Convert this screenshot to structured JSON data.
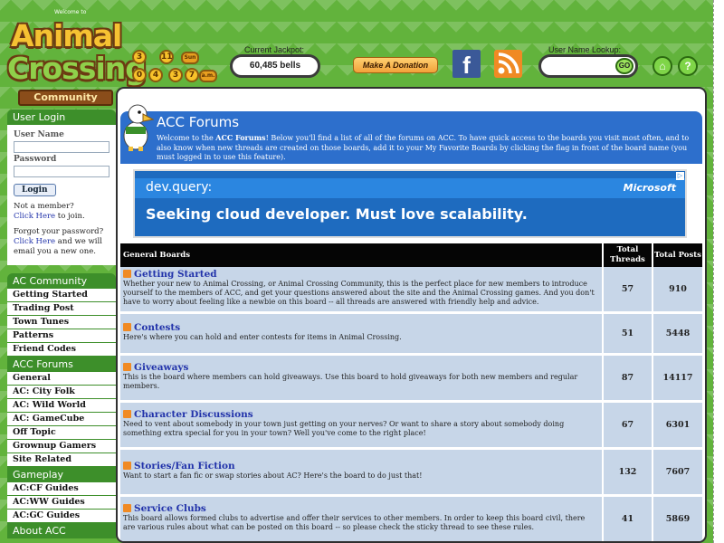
{
  "header": {
    "logo_welcome": "Welcome to",
    "logo_line1": "Animal",
    "logo_line2": "Crossing",
    "logo_community": "Community",
    "clock": {
      "month": "3",
      "day": "11",
      "weekday": "Sun",
      "h1": "0",
      "h2": "4",
      "m1": "3",
      "m2": "7",
      "ampm": "a.m."
    },
    "jackpot_label": "Current Jackpot:",
    "jackpot_value": "60,485 bells",
    "donate_label": "Make A Donation",
    "lookup_label": "User Name Lookup:",
    "lookup_button": "GO",
    "facebook_glyph": "f",
    "home_glyph": "⌂",
    "help_glyph": "?"
  },
  "sidebar": {
    "login_title": "User Login",
    "username_label": "User Name",
    "password_label": "Password",
    "login_button": "Login",
    "not_member": "Not a member?",
    "click_here": "Click Here",
    "to_join": " to join.",
    "forgot": "Forgot your password?",
    "forgot_click": "Click Here",
    "forgot_rest": " and we will email you a new one.",
    "sections": [
      {
        "title": "AC Community",
        "items": [
          "Getting Started",
          "Trading Post",
          "Town Tunes",
          "Patterns",
          "Friend Codes"
        ]
      },
      {
        "title": "ACC Forums",
        "items": [
          "General",
          "AC: City Folk",
          "AC: Wild World",
          "AC: GameCube",
          "Off Topic",
          "Grownup Gamers",
          "Site Related"
        ]
      },
      {
        "title": "Gameplay",
        "items": [
          "AC:CF Guides",
          "AC:WW Guides",
          "AC:GC Guides"
        ]
      },
      {
        "title": "About ACC",
        "items": []
      }
    ]
  },
  "main": {
    "title": "ACC Forums",
    "desc_pre": "Welcome to the ",
    "desc_bold": "ACC Forums",
    "desc_post": "! Below you'll find a list of all of the forums on ACC. To have quick access to the boards you visit most often, and to also know when new threads are created on those boards, add it to your My Favorite Boards by clicking the flag in front of the board name (you must logged in to use this feature).",
    "ad": {
      "query": "dev.query:",
      "brand": "Microsoft",
      "line": "Seeking cloud developer. Must love scalability.",
      "mark": "▷"
    },
    "table": {
      "col_name": "General Boards",
      "col_threads": "Total Threads",
      "col_posts": "Total Posts",
      "rows": [
        {
          "name": "Getting Started",
          "desc": "Whether your new to Animal Crossing, or Animal Crossing Community, this is the perfect place for new members to introduce yourself to the members of ACC, and get your questions answered about the site and the Animal Crossing games. And you don't have to worry about feeling like a newbie on this board -- all threads are answered with friendly help and advice.",
          "threads": "57",
          "posts": "910"
        },
        {
          "name": "Contests",
          "desc": "Here's where you can hold and enter contests for items in Animal Crossing.",
          "threads": "51",
          "posts": "5448"
        },
        {
          "name": "Giveaways",
          "desc": "This is the board where members can hold giveaways. Use this board to hold giveaways for both new members and regular members.",
          "threads": "87",
          "posts": "14117"
        },
        {
          "name": "Character Discussions",
          "desc": "Need to vent about somebody in your town just getting on your nerves? Or want to share a story about somebody doing something extra special for you in your town? Well you've come to the right place!",
          "threads": "67",
          "posts": "6301"
        },
        {
          "name": "Stories/Fan Fiction",
          "desc": "Want to start a fan fic or swap stories about AC? Here's the board to do just that!",
          "threads": "132",
          "posts": "7607"
        },
        {
          "name": "Service Clubs",
          "desc": "This board allows formed clubs to advertise and offer their services to other members. In order to keep this board civil, there are various rules about what can be posted on this board -- so please check the sticky thread to see these rules.",
          "threads": "41",
          "posts": "5869"
        }
      ]
    }
  }
}
